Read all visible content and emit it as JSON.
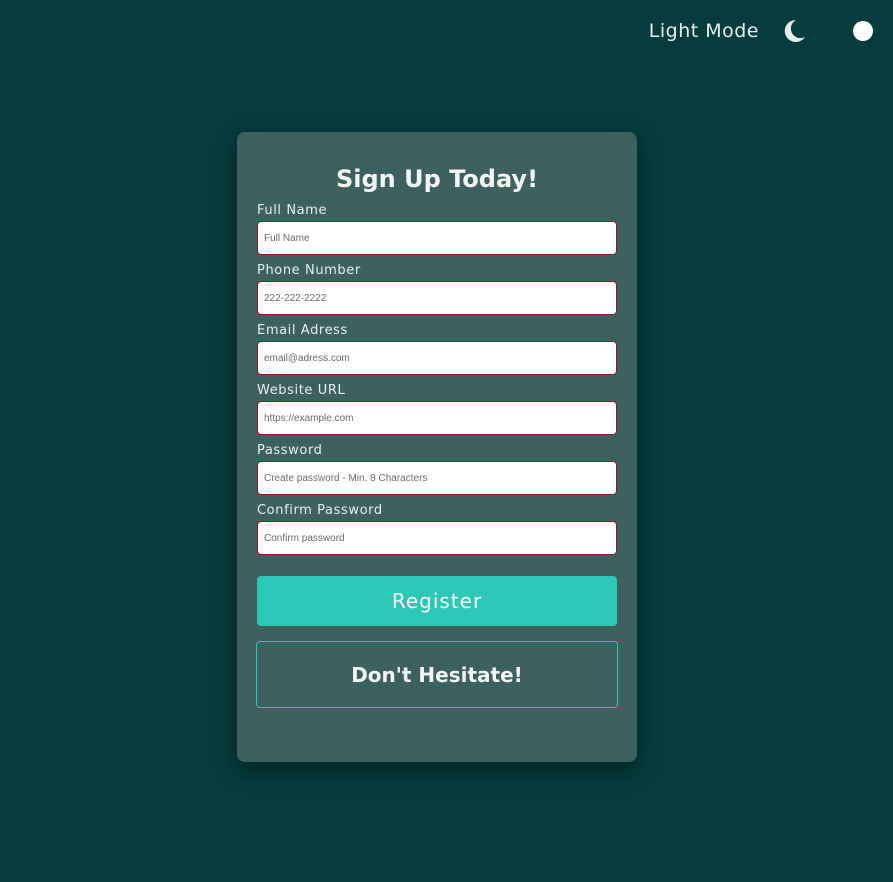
{
  "theme_switch": {
    "label": "Light Mode",
    "icon": "moon-icon",
    "knob_color": "#ffffff"
  },
  "form": {
    "title": "Sign Up Today!",
    "fields": [
      {
        "label": "Full Name",
        "placeholder": "Full Name",
        "value": ""
      },
      {
        "label": "Phone Number",
        "placeholder": "222-222-2222",
        "value": ""
      },
      {
        "label": "Email Adress",
        "placeholder": "email@adress.com",
        "value": ""
      },
      {
        "label": "Website URL",
        "placeholder": "https://example.com",
        "value": ""
      },
      {
        "label": "Password",
        "placeholder": "Create password - Min. 8 Characters",
        "value": ""
      },
      {
        "label": "Confirm Password",
        "placeholder": "Confirm password",
        "value": ""
      }
    ],
    "register_label": "Register",
    "cta_text": "Don't Hesitate!"
  },
  "colors": {
    "background": "#053d3d",
    "card": "#3d615f",
    "accent": "#2dc7b6",
    "input_border": "#8b1c24"
  }
}
